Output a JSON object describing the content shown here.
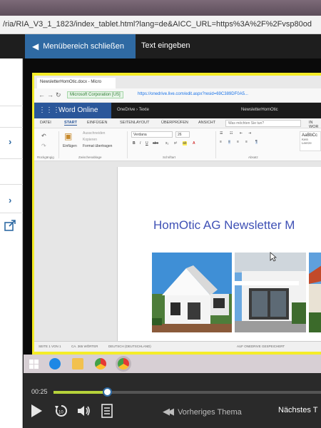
{
  "browser": {
    "url": "/ria/RIA_V3_1_1823/index_tablet.html?lang=de&AICC_URL=https%3A%2F%2Fvsp80od"
  },
  "header": {
    "menu_close_label": "Menübereich schließen",
    "text_input_label": "Text eingeben"
  },
  "screen": {
    "tab_title": "NewsletterHomOtic.docx - Micro",
    "secure_label": "Microsoft Corporation [US]",
    "url": "https://onedrive.live.com/edit.aspx?resid=69C389DF0A5...",
    "word": {
      "app_name": "Word Online",
      "breadcrumb": "OneDrive › Texte",
      "doc_name": "NewsletterHomOtic",
      "tabs": [
        "DATEI",
        "START",
        "EINFÜGEN",
        "SEITENLAYOUT",
        "ÜBERPRÜFEN",
        "ANSICHT"
      ],
      "active_tab": "START",
      "search_placeholder": "Was möchten Sie tun?",
      "in_word": "IN WOR",
      "ribbon": {
        "undo_group": "Rückgängig",
        "paste_label": "Einfügen",
        "cut_label": "Ausschneiden",
        "copy_label": "Kopieren",
        "format_label": "Format übertragen",
        "clipboard_group": "Zwischenablage",
        "font_name": "Verdana",
        "font_size": "26",
        "font_group": "Schriftart",
        "paragraph_group": "Absatz",
        "style_label": "AaBbCc",
        "style_name": "Kein Leerze"
      },
      "doc_title": "HomOtic AG Newsletter M",
      "status_page": "SEITE 1 VON 1",
      "status_words": "CA. 365 WÖRTER",
      "status_lang": "DEUTSCH (DEUTSCHLAND)",
      "status_save": "AUF ONEDRIVE GESPEICHERT"
    }
  },
  "player": {
    "time": "00:25",
    "progress": 0.2,
    "prev_topic": "Vorheriges Thema",
    "next_topic": "Nächstes T"
  },
  "colors": {
    "accent_blue": "#2f6aa3",
    "word_blue": "#2b579a",
    "progress_green": "#b6d23a",
    "highlight_yellow": "#f4ec28"
  }
}
